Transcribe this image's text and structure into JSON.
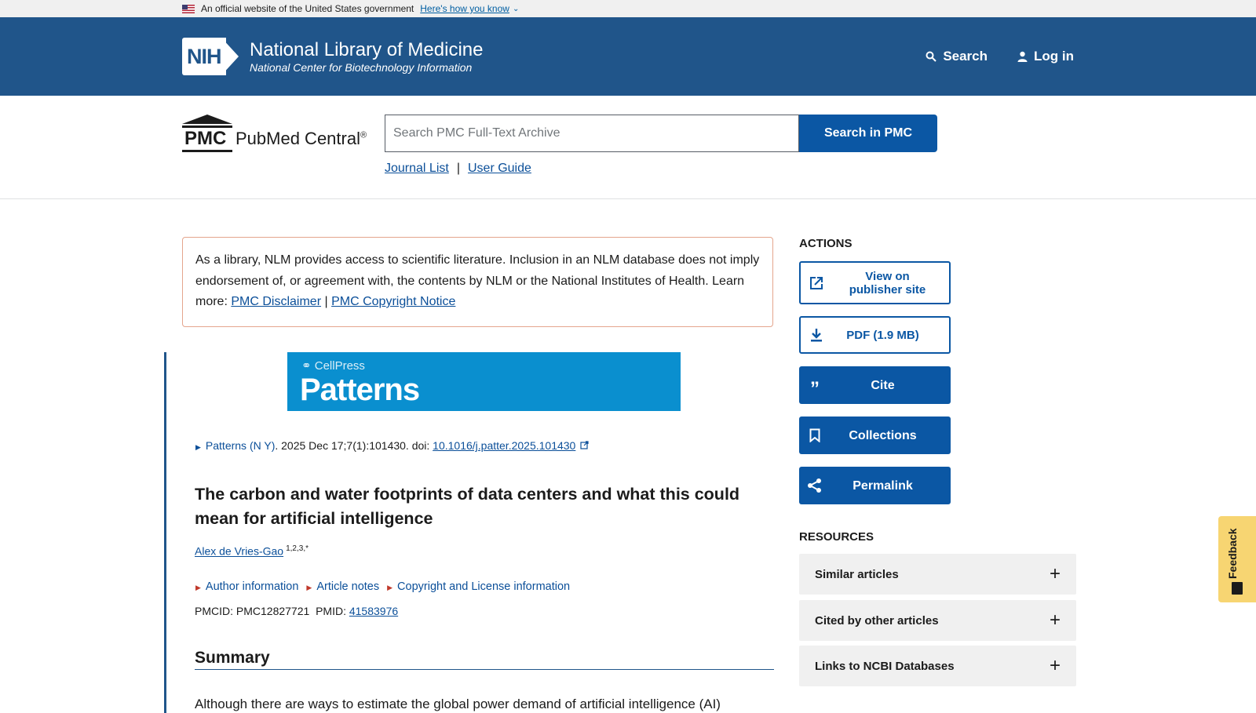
{
  "gov_banner": {
    "text": "An official website of the United States government",
    "link": "Here's how you know"
  },
  "nih": {
    "badge": "NIH",
    "title": "National Library of Medicine",
    "subtitle": "National Center for Biotechnology Information",
    "search_label": "Search",
    "login_label": "Log in"
  },
  "pmc": {
    "letters": "PMC",
    "name": "PubMed Central",
    "reg": "®",
    "search_placeholder": "Search PMC Full-Text Archive",
    "search_button": "Search in PMC",
    "journal_list": "Journal List",
    "separator": "|",
    "user_guide": "User Guide"
  },
  "disclaimer": {
    "text": "As a library, NLM provides access to scientific literature. Inclusion in an NLM database does not imply endorsement of, or agreement with, the contents by NLM or the National Institutes of Health.",
    "learn_more": "Learn more:",
    "link1": "PMC Disclaimer",
    "sep": "|",
    "link2": "PMC Copyright Notice"
  },
  "journal_banner": {
    "publisher": "CellPress",
    "journal": "Patterns"
  },
  "citation": {
    "journal": "Patterns (N Y)",
    "details": ". 2025 Dec 17;7(1):101430. doi: ",
    "doi": "10.1016/j.patter.2025.101430"
  },
  "article": {
    "title": "The carbon and water footprints of data centers and what this could mean for artificial intelligence",
    "author": "Alex de Vries-Gao",
    "author_sup": "1,2,3,*",
    "links": [
      "Author information",
      "Article notes",
      "Copyright and License information"
    ],
    "pmcid_label": "PMCID: PMC12827721",
    "pmid_label": "PMID:",
    "pmid": "41583976",
    "section": "Summary",
    "abstract_start": "Although there are ways to estimate the global power demand of artificial intelligence (AI)"
  },
  "sidebar": {
    "actions_heading": "ACTIONS",
    "view_publisher": "View on publisher site",
    "pdf": "PDF (1.9 MB)",
    "cite": "Cite",
    "collections": "Collections",
    "permalink": "Permalink",
    "resources_heading": "RESOURCES",
    "resources": [
      "Similar articles",
      "Cited by other articles",
      "Links to NCBI Databases"
    ]
  },
  "feedback": "Feedback",
  "colors": {
    "nih_blue": "#20558a",
    "button_blue": "#0b57a4",
    "journal_banner": "#0a8fcf",
    "feedback_yellow": "#f7d572"
  }
}
